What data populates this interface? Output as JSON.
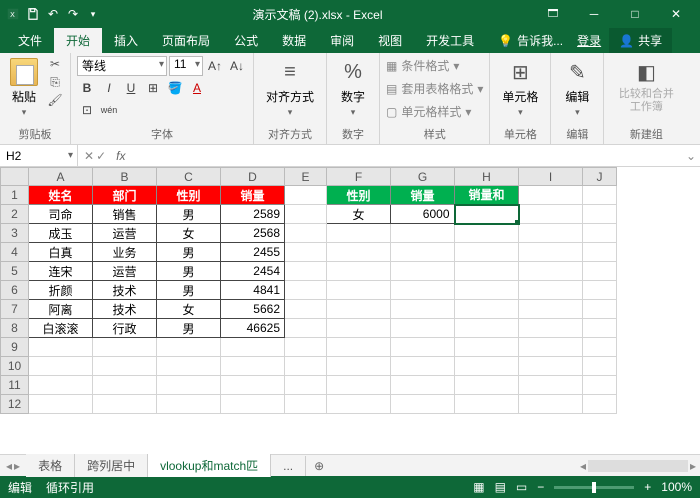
{
  "titlebar": {
    "title": "演示文稿 (2).xlsx - Excel"
  },
  "tabs": {
    "items": [
      "文件",
      "开始",
      "插入",
      "页面布局",
      "公式",
      "数据",
      "审阅",
      "视图",
      "开发工具"
    ],
    "tell": "告诉我...",
    "login": "登录",
    "share": "共享",
    "active": 1
  },
  "ribbon": {
    "clipboard": {
      "paste": "粘贴",
      "group": "剪贴板"
    },
    "font": {
      "family": "等线",
      "size": "11",
      "group": "字体"
    },
    "align": {
      "label": "对齐方式",
      "group": "对齐方式"
    },
    "number": {
      "label": "数字",
      "group": "数字"
    },
    "styles": {
      "cond": "条件格式",
      "tbl": "套用表格格式",
      "cell": "单元格样式",
      "group": "样式"
    },
    "cells": {
      "label": "单元格",
      "group": "单元格"
    },
    "edit": {
      "label": "编辑",
      "group": "编辑"
    },
    "compare": {
      "label": "比较和合并工作簿",
      "group": "新建组"
    }
  },
  "namebox": {
    "ref": "H2",
    "formula": ""
  },
  "headers": [
    "A",
    "B",
    "C",
    "D",
    "E",
    "F",
    "G",
    "H",
    "I",
    "J"
  ],
  "table1": {
    "head": [
      "姓名",
      "部门",
      "性别",
      "销量"
    ],
    "rows": [
      [
        "司命",
        "销售",
        "男",
        "2589"
      ],
      [
        "成玉",
        "运营",
        "女",
        "2568"
      ],
      [
        "白真",
        "业务",
        "男",
        "2455"
      ],
      [
        "连宋",
        "运营",
        "男",
        "2454"
      ],
      [
        "折颜",
        "技术",
        "男",
        "4841"
      ],
      [
        "阿离",
        "技术",
        "女",
        "5662"
      ],
      [
        "白滚滚",
        "行政",
        "男",
        "46625"
      ]
    ]
  },
  "table2": {
    "head": [
      "性别",
      "销量",
      "销量和"
    ],
    "row": [
      "女",
      "6000",
      ""
    ]
  },
  "sheets": {
    "tabs": [
      "表格",
      "跨列居中",
      "vlookup和match匹"
    ],
    "active": 0,
    "more": "..."
  },
  "status": {
    "mode": "编辑",
    "circ": "循环引用",
    "zoom": "100%"
  },
  "selected_cell": "H2"
}
